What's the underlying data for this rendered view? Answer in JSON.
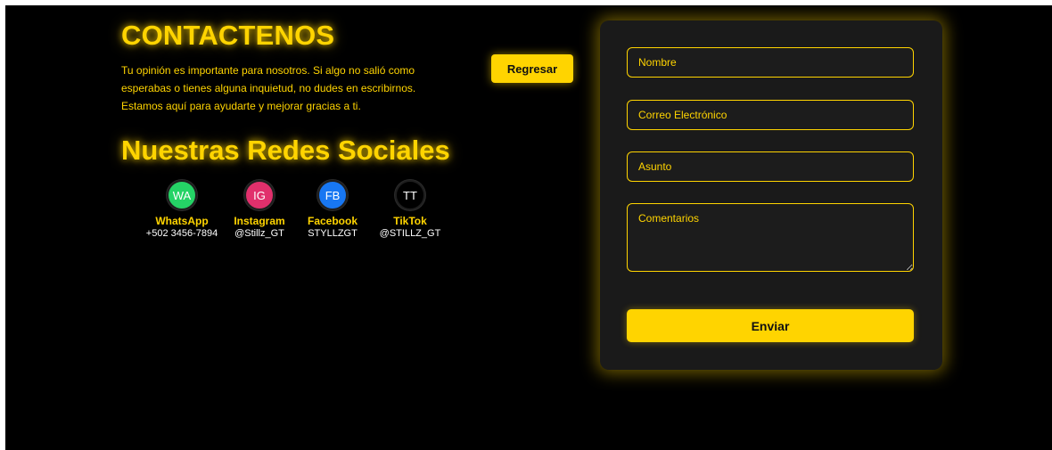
{
  "contact": {
    "title": "CONTACTENOS",
    "intro": "Tu opinión es importante para nosotros. Si algo no salió como esperabas o tienes alguna inquietud, no dudes en escribirnos. Estamos aquí para ayudarte y mejorar gracias a ti."
  },
  "social": {
    "title": "Nuestras Redes Sociales",
    "items": [
      {
        "icon": "whatsapp-icon",
        "icon_text": "WA",
        "name": "WhatsApp",
        "handle": "+502 3456-7894",
        "color": "#25D366"
      },
      {
        "icon": "instagram-icon",
        "icon_text": "IG",
        "name": "Instagram",
        "handle": "@Stillz_GT",
        "color": "#E1306C"
      },
      {
        "icon": "facebook-icon",
        "icon_text": "FB",
        "name": "Facebook",
        "handle": "STYLLZGT",
        "color": "#1877F2"
      },
      {
        "icon": "tiktok-icon",
        "icon_text": "TT",
        "name": "TikTok",
        "handle": "@STILLZ_GT",
        "color": "#000000"
      }
    ]
  },
  "nav": {
    "back_label": "Regresar"
  },
  "form": {
    "name_placeholder": "Nombre",
    "email_placeholder": "Correo Electrónico",
    "subject_placeholder": "Asunto",
    "comments_placeholder": "Comentarios",
    "submit_label": "Enviar"
  },
  "colors": {
    "accent": "#FFD400",
    "background": "#000000",
    "card": "#1A1A1A"
  }
}
